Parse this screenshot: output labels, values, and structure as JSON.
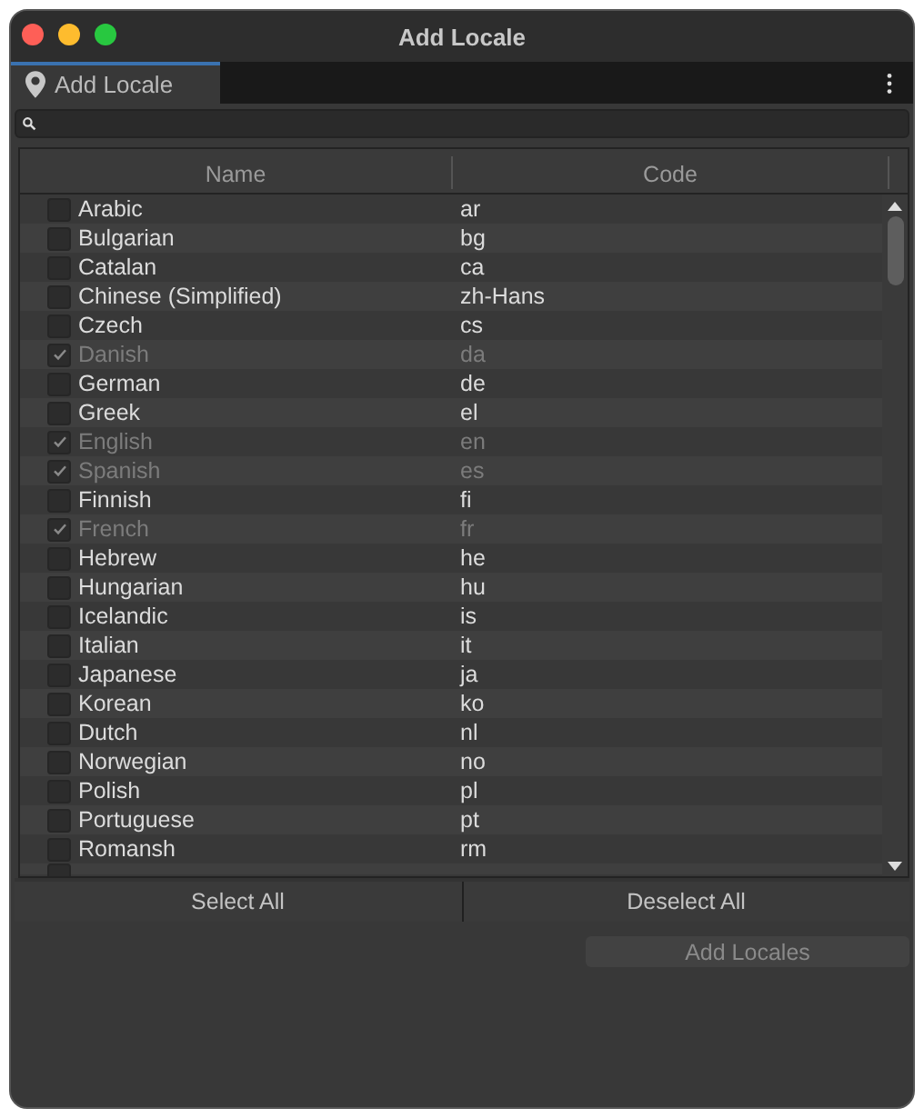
{
  "window": {
    "title": "Add Locale"
  },
  "tabs": [
    {
      "label": "Add Locale",
      "selected": true
    }
  ],
  "table": {
    "columns": [
      "Name",
      "Code"
    ],
    "rows": [
      {
        "name": "Arabic",
        "code": "ar",
        "checked": false
      },
      {
        "name": "Bulgarian",
        "code": "bg",
        "checked": false
      },
      {
        "name": "Catalan",
        "code": "ca",
        "checked": false
      },
      {
        "name": "Chinese (Simplified)",
        "code": "zh-Hans",
        "checked": false
      },
      {
        "name": "Czech",
        "code": "cs",
        "checked": false
      },
      {
        "name": "Danish",
        "code": "da",
        "checked": true
      },
      {
        "name": "German",
        "code": "de",
        "checked": false
      },
      {
        "name": "Greek",
        "code": "el",
        "checked": false
      },
      {
        "name": "English",
        "code": "en",
        "checked": true
      },
      {
        "name": "Spanish",
        "code": "es",
        "checked": true
      },
      {
        "name": "Finnish",
        "code": "fi",
        "checked": false
      },
      {
        "name": "French",
        "code": "fr",
        "checked": true
      },
      {
        "name": "Hebrew",
        "code": "he",
        "checked": false
      },
      {
        "name": "Hungarian",
        "code": "hu",
        "checked": false
      },
      {
        "name": "Icelandic",
        "code": "is",
        "checked": false
      },
      {
        "name": "Italian",
        "code": "it",
        "checked": false
      },
      {
        "name": "Japanese",
        "code": "ja",
        "checked": false
      },
      {
        "name": "Korean",
        "code": "ko",
        "checked": false
      },
      {
        "name": "Dutch",
        "code": "nl",
        "checked": false
      },
      {
        "name": "Norwegian",
        "code": "no",
        "checked": false
      },
      {
        "name": "Polish",
        "code": "pl",
        "checked": false
      },
      {
        "name": "Portuguese",
        "code": "pt",
        "checked": false
      },
      {
        "name": "Romansh",
        "code": "rm",
        "checked": false
      }
    ],
    "partial_row": {
      "checked": false
    }
  },
  "selection_buttons": [
    "Select All",
    "Deselect All"
  ],
  "add_button": {
    "label": "Add Locales",
    "disabled": true
  }
}
